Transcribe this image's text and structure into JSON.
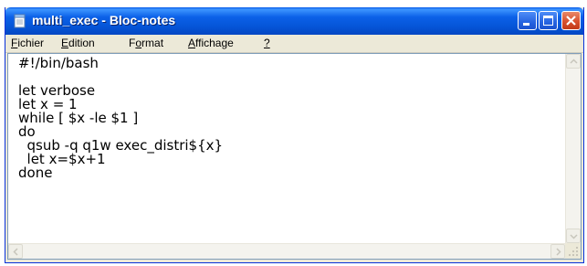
{
  "window": {
    "title": "multi_exec - Bloc-notes"
  },
  "menu": [
    {
      "pre": "",
      "acc": "F",
      "post": "ichier"
    },
    {
      "pre": "",
      "acc": "E",
      "post": "dition"
    },
    {
      "pre": "F",
      "acc": "o",
      "post": "rmat"
    },
    {
      "pre": "",
      "acc": "A",
      "post": "ffichage"
    },
    {
      "pre": "",
      "acc": "?",
      "post": ""
    }
  ],
  "document": {
    "lines": [
      "#!/bin/bash",
      "",
      "let verbose",
      "let x = 1",
      "while [ $x -le $1 ]",
      "do",
      "  qsub -q q1w exec_distri${x}",
      "  let x=$x+1",
      "done"
    ]
  },
  "colors": {
    "title_bar": "#0c61e8",
    "window_frame": "#0831d9",
    "close_button": "#d8512f",
    "editor_background": "#ffffff"
  },
  "icons": {
    "app": "notepad-icon",
    "minimize": "minimize-icon",
    "maximize": "maximize-icon",
    "close": "close-icon"
  }
}
